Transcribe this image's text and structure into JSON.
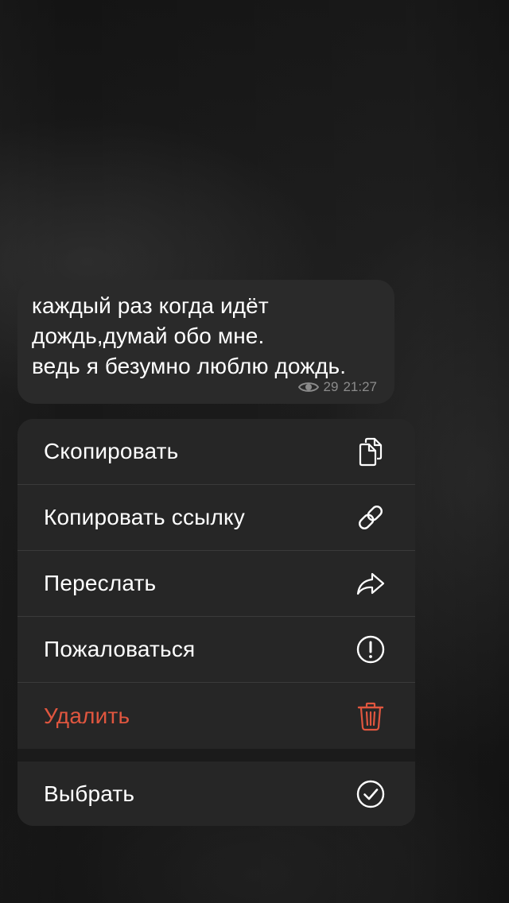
{
  "message": {
    "lines": [
      "каждый раз когда идёт",
      "дождь,думай обо мне.",
      "ведь я безумно люблю дождь."
    ],
    "views": "29",
    "time": "21:27",
    "views_icon": "eye-icon"
  },
  "menu": {
    "items": [
      {
        "label": "Скопировать",
        "icon": "copy-icon"
      },
      {
        "label": "Копировать ссылку",
        "icon": "link-icon"
      },
      {
        "label": "Переслать",
        "icon": "forward-icon"
      },
      {
        "label": "Пожаловаться",
        "icon": "report-icon"
      },
      {
        "label": "Удалить",
        "icon": "trash-icon",
        "destructive": true
      }
    ],
    "select": {
      "label": "Выбрать",
      "icon": "checkmark-circle-icon"
    }
  },
  "colors": {
    "destructive": "#e0563f",
    "bubble": "#2a2a2a",
    "menu": "#262626"
  }
}
